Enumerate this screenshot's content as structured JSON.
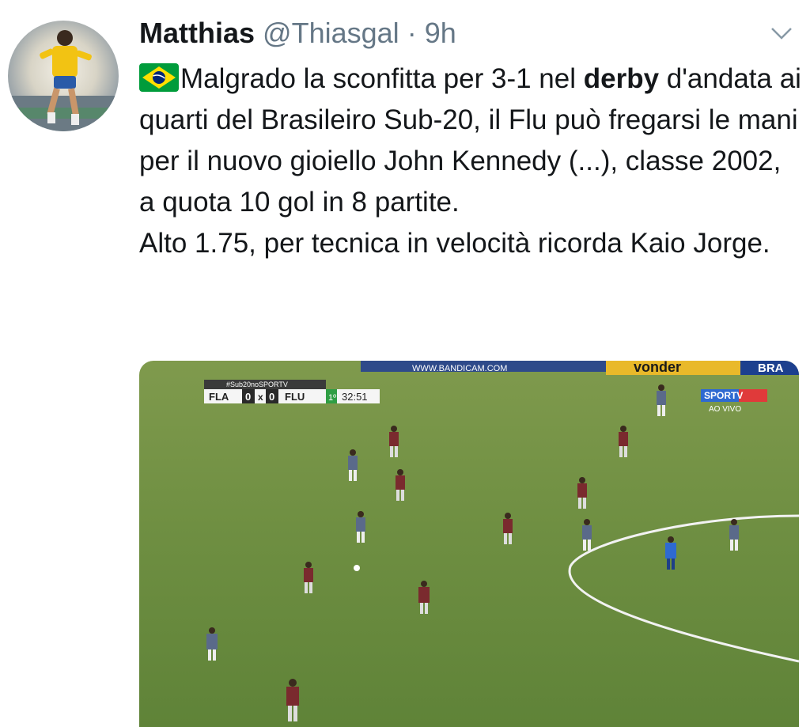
{
  "tweet": {
    "author_name": "Matthias",
    "handle": "@Thiasgal",
    "separator": "·",
    "time": "9h",
    "text": {
      "part1": "Malgrado la sconfitta per 3-1 nel ",
      "bold": "derby",
      "part2": " d'andata ai quarti del Brasileiro Sub-20, il Flu può fregarsi le mani per il nuovo gioiello John Kennedy (...), classe 2002, a quota 10 gol in 8 partite.",
      "line2": "Alto 1.75, per tecnica in velocità ricorda Kaio Jorge."
    }
  },
  "media": {
    "ad_watermark": "WWW.BANDICAM.COM",
    "ad_brand_1": "vonder",
    "ad_brand_2": "BRA",
    "hashtag": "#Sub20noSPORTV",
    "score": {
      "home_team": "FLA",
      "home_score": "0",
      "sep": "x",
      "away_score": "0",
      "away_team": "FLU",
      "period": "1º",
      "clock": "32:51"
    },
    "channel": "SPORTV",
    "live_label": "AO VIVO"
  },
  "colors": {
    "pitch": "#6f8f42",
    "flag_green": "#009c3b",
    "flag_yellow": "#ffdf00",
    "flag_blue": "#002776",
    "text": "#14171a",
    "secondary_text": "#657786"
  }
}
